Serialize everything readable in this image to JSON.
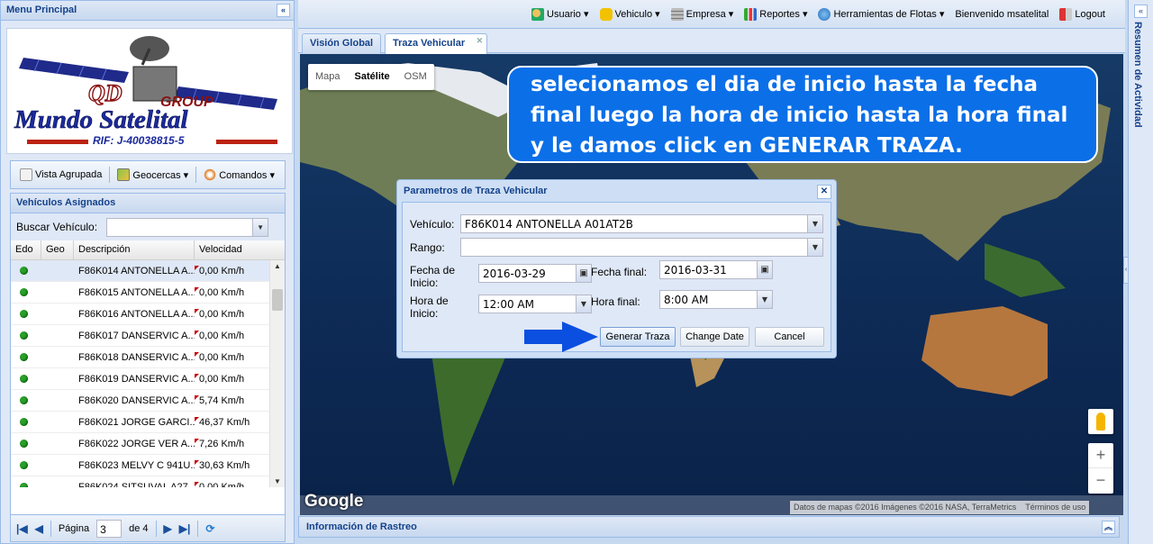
{
  "left_panel": {
    "title": "Menu Principal",
    "collapse_icon": "double-chevron-left",
    "logo": {
      "line1": "QD",
      "line2": "GROUP",
      "line3": "Mundo Satelital",
      "rif": "RIF: J-40038815-5"
    },
    "toolbar": [
      {
        "label": "Vista Agrupada",
        "icon": "document-icon"
      },
      {
        "label": "Geocercas ▾",
        "icon": "map-icon"
      },
      {
        "label": "Comandos ▾",
        "icon": "satellite-dish-icon"
      }
    ],
    "vehicles": {
      "title": "Vehículos Asignados",
      "search_label": "Buscar Vehículo:",
      "search_value": "",
      "columns": [
        "Edo",
        "Geo",
        "Descripción",
        "Velocidad"
      ],
      "rows": [
        {
          "desc": "F86K014 ANTONELLA A...",
          "speed": "0,00 Km/h",
          "selected": true
        },
        {
          "desc": "F86K015 ANTONELLA A...",
          "speed": "0,00 Km/h"
        },
        {
          "desc": "F86K016 ANTONELLA A...",
          "speed": "0,00 Km/h"
        },
        {
          "desc": "F86K017 DANSERVIC A...",
          "speed": "0,00 Km/h"
        },
        {
          "desc": "F86K018 DANSERVIC A...",
          "speed": "0,00 Km/h"
        },
        {
          "desc": "F86K019 DANSERVIC A...",
          "speed": "0,00 Km/h"
        },
        {
          "desc": "F86K020 DANSERVIC A...",
          "speed": "5,74 Km/h"
        },
        {
          "desc": "F86K021 JORGE GARCI...",
          "speed": "46,37 Km/h"
        },
        {
          "desc": "F86K022 JORGE VER A...",
          "speed": "7,26 Km/h"
        },
        {
          "desc": "F86K023 MELVY C 941U...",
          "speed": "30,63 Km/h"
        },
        {
          "desc": "F86K024 SITSUVAL A27...",
          "speed": "0,00 Km/h"
        }
      ],
      "pager": {
        "page_label": "Página",
        "page": "3",
        "of_label": "de 4"
      }
    }
  },
  "topnav": {
    "items": [
      {
        "label": "Usuario ▾",
        "icon": "users-icon"
      },
      {
        "label": "Vehiculo ▾",
        "icon": "car-icon"
      },
      {
        "label": "Empresa ▾",
        "icon": "building-icon"
      },
      {
        "label": "Reportes ▾",
        "icon": "bar-chart-icon"
      },
      {
        "label": "Herramientas de Flotas ▾",
        "icon": "globe-icon"
      }
    ],
    "welcome": "Bienvenido msatelital",
    "logout": "Logout"
  },
  "tabs": [
    {
      "label": "Visión Global",
      "active": false
    },
    {
      "label": "Traza Vehicular",
      "active": true,
      "closable": true
    }
  ],
  "map": {
    "types": [
      "Mapa",
      "Satélite",
      "OSM"
    ],
    "active_type": "Satélite",
    "google": "Google",
    "attribution": "Datos de mapas ©2016 Imágenes ©2016 NASA, TerraMetrics",
    "terms": "Términos de uso"
  },
  "callout": {
    "text": "selecionamos el dia de inicio hasta la fecha final luego la hora de inicio hasta la hora final y le damos click en GENERAR TRAZA."
  },
  "dialog": {
    "title": "Parametros de Traza Vehicular",
    "vehiculo_label": "Vehículo:",
    "vehiculo_value": "F86K014 ANTONELLA A01AT2B",
    "rango_label": "Rango:",
    "rango_value": "",
    "fecha_inicio_label": "Fecha de Inicio:",
    "fecha_inicio_value": "2016-03-29",
    "fecha_final_label": "Fecha final:",
    "fecha_final_value": "2016-03-31",
    "hora_inicio_label": "Hora de Inicio:",
    "hora_inicio_value": "12:00 AM",
    "hora_final_label": "Hora final:",
    "hora_final_value": "8:00 AM",
    "buttons": {
      "generate": "Generar Traza",
      "change": "Change Date",
      "cancel": "Cancel"
    }
  },
  "bottom_panel": {
    "title": "Información de Rastreo"
  },
  "right_panel": {
    "title": "Resumen de Actividad"
  },
  "colors": {
    "callout": "#0b6fe8",
    "arrow": "#0a4fe0",
    "panel_border": "#99bbe8",
    "header_text": "#15428b"
  }
}
